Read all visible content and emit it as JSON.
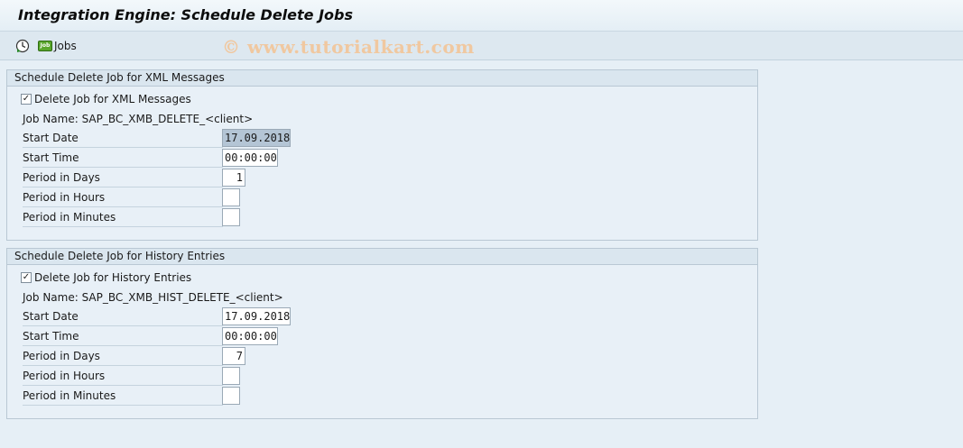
{
  "title": "Integration Engine: Schedule Delete Jobs",
  "toolbar": {
    "execute_icon": "clock-execute-icon",
    "jobs_badge": "Job",
    "jobs_label": "Jobs",
    "watermark": "© www.tutorialkart.com"
  },
  "xml_group": {
    "header": "Schedule Delete Job for XML Messages",
    "checkbox_label": "Delete Job for XML Messages",
    "checkbox_checked": true,
    "job_name": "Job Name: SAP_BC_XMB_DELETE_<client>",
    "start_date_label": "Start Date",
    "start_date": "17.09.2018",
    "start_time_label": "Start Time",
    "start_time": "00:00:00",
    "days_label": "Period in Days",
    "days": "1",
    "hours_label": "Period in Hours",
    "hours": "",
    "minutes_label": "Period in Minutes",
    "minutes": ""
  },
  "hist_group": {
    "header": "Schedule Delete Job for History Entries",
    "checkbox_label": "Delete Job for History Entries",
    "checkbox_checked": true,
    "job_name": "Job Name: SAP_BC_XMB_HIST_DELETE_<client>",
    "start_date_label": "Start Date",
    "start_date": "17.09.2018",
    "start_time_label": "Start Time",
    "start_time": "00:00:00",
    "days_label": "Period in Days",
    "days": "7",
    "hours_label": "Period in Hours",
    "hours": "",
    "minutes_label": "Period in Minutes",
    "minutes": ""
  }
}
